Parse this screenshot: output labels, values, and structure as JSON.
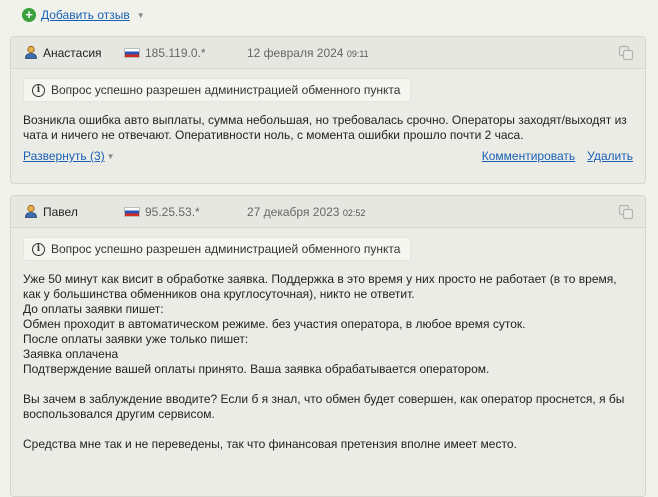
{
  "add_review": {
    "label": "Добавить отзыв"
  },
  "reviews": [
    {
      "author": "Анастасия",
      "ip": "185.119.0.*",
      "date": "12 февраля 2024",
      "time": "09:11",
      "notice": "Вопрос успешно разрешен администрацией обменного пункта",
      "paragraphs": [
        "Возникла ошибка авто выплаты, сумма небольшая, но требовалась срочно. Операторы заходят/выходят из чата и ничего не отвечают. Оперативности ноль, с момента ошибки прошло почти 2 часа."
      ],
      "expand_label": "Развернуть (3)",
      "comment_label": "Комментировать",
      "delete_label": "Удалить"
    },
    {
      "author": "Павел",
      "ip": "95.25.53.*",
      "date": "27 декабря 2023",
      "time": "02:52",
      "notice": "Вопрос успешно разрешен администрацией обменного пункта",
      "lines": [
        "Уже 50 минут как висит в обработке заявка. Поддержка в это время у них просто не работает (в то время, как у большинства обменников она круглосуточная), никто не ответит.",
        "До оплаты заявки пишет:",
        "Обмен проходит в автоматическом режиме. без участия оператора, в любое время суток.",
        "После оплаты заявки уже только пишет:",
        "Заявка оплачена",
        "Подтверждение вашей оплаты принято. Ваша заявка обрабатывается оператором."
      ],
      "para2": "Вы зачем в заблуждение вводите? Если б я знал, что обмен будет совершен, как оператор проснется, я бы воспользовался другим сервисом.",
      "para3": "Средства мне так и не переведены, так что финансовая претензия вполне имеет место."
    }
  ]
}
